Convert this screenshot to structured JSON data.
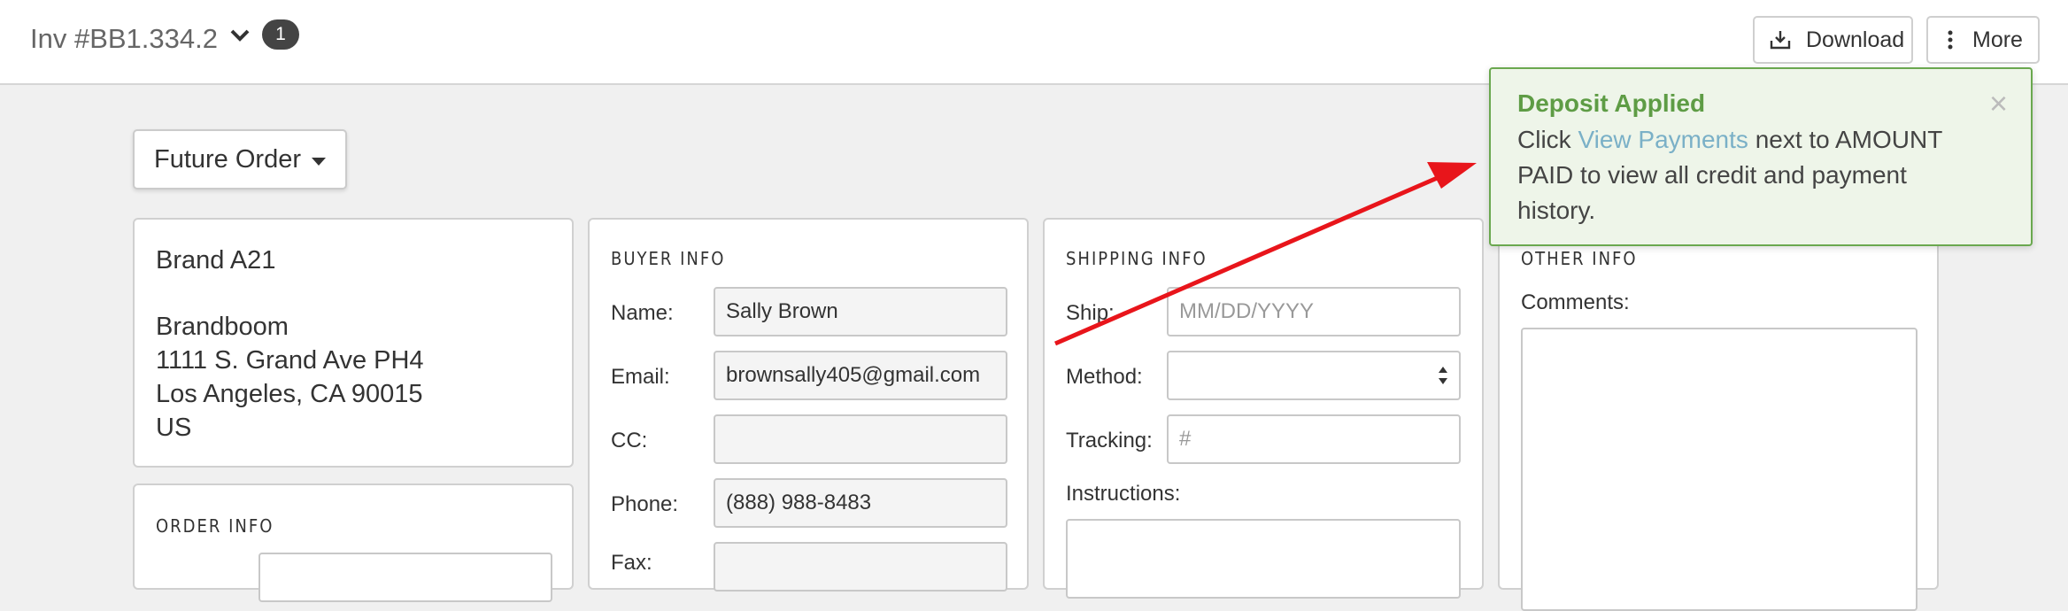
{
  "header": {
    "invoice_title": "Inv #BB1.334.2",
    "badge_count": "1",
    "download_label": "Download",
    "more_label": "More"
  },
  "order_type": {
    "selected": "Future Order"
  },
  "brand_card": {
    "brand_name": "Brand A21",
    "address_lines": [
      "Brandboom",
      "1111 S. Grand Ave PH4",
      "Los Angeles, CA 90015",
      "US"
    ]
  },
  "buyer_info": {
    "title": "BUYER INFO",
    "name_label": "Name:",
    "name_value": "Sally Brown",
    "email_label": "Email:",
    "email_value": "brownsally405@gmail.com",
    "cc_label": "CC:",
    "cc_value": "",
    "phone_label": "Phone:",
    "phone_value": "(888) 988-8483",
    "fax_label": "Fax:"
  },
  "shipping_info": {
    "title": "SHIPPING INFO",
    "ship_label": "Ship:",
    "ship_placeholder": "MM/DD/YYYY",
    "method_label": "Method:",
    "method_value": "",
    "tracking_label": "Tracking:",
    "tracking_placeholder": "#",
    "instructions_label": "Instructions:"
  },
  "other_info": {
    "title": "OTHER INFO",
    "comments_label": "Comments:"
  },
  "order_info": {
    "title": "ORDER INFO"
  },
  "toast": {
    "title": "Deposit Applied",
    "text_before": "Click ",
    "link_text": "View Payments",
    "text_after": " next to AMOUNT PAID to view all credit and payment history.",
    "close_glyph": "×"
  },
  "colors": {
    "toast_border": "#6aa84f",
    "toast_title": "#5e9c45",
    "toast_bg": "#eef5e9",
    "link": "#7ab0c7",
    "annotation_arrow": "#e8151b",
    "badge_bg": "#444444"
  }
}
